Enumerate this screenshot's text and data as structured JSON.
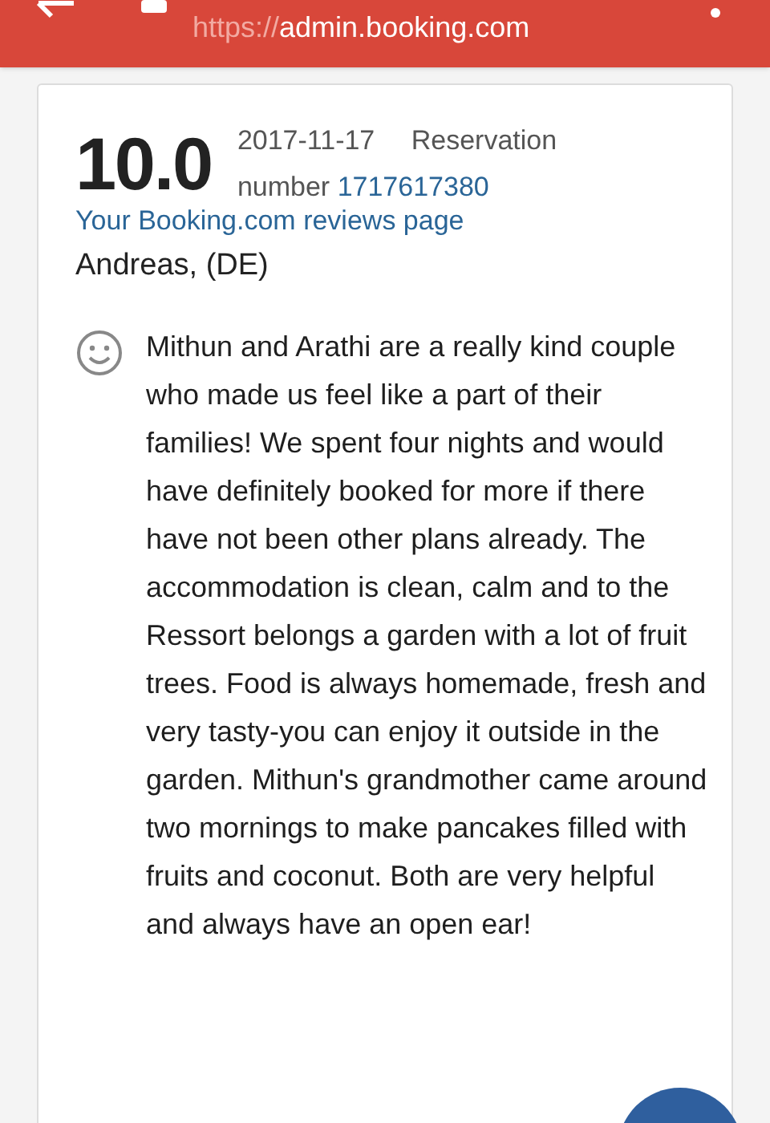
{
  "browser_bar": {
    "url_scheme": "https://",
    "url_host": "admin.booking.com"
  },
  "review": {
    "score": "10.0",
    "date": "2017-11-17",
    "reservation_label": "Reservation number",
    "reservation_number": "1717617380",
    "reviews_link": "Your Booking.com reviews page",
    "guest": "Andreas, (DE)",
    "text": "Mithun and Arathi are a really kind couple who made us feel like a part of their families! We spent four nights and would have definitely booked for more if there have not been other plans already. The accommodation is clean, calm and to the Ressort belongs a garden with a lot of fruit trees. Food is always homemade, fresh and very tasty-you can enjoy it outside in the garden. Mithun's grandmother came around two mornings to make pancakes filled with fruits and coconut. Both are very helpful and always have an open ear!"
  }
}
